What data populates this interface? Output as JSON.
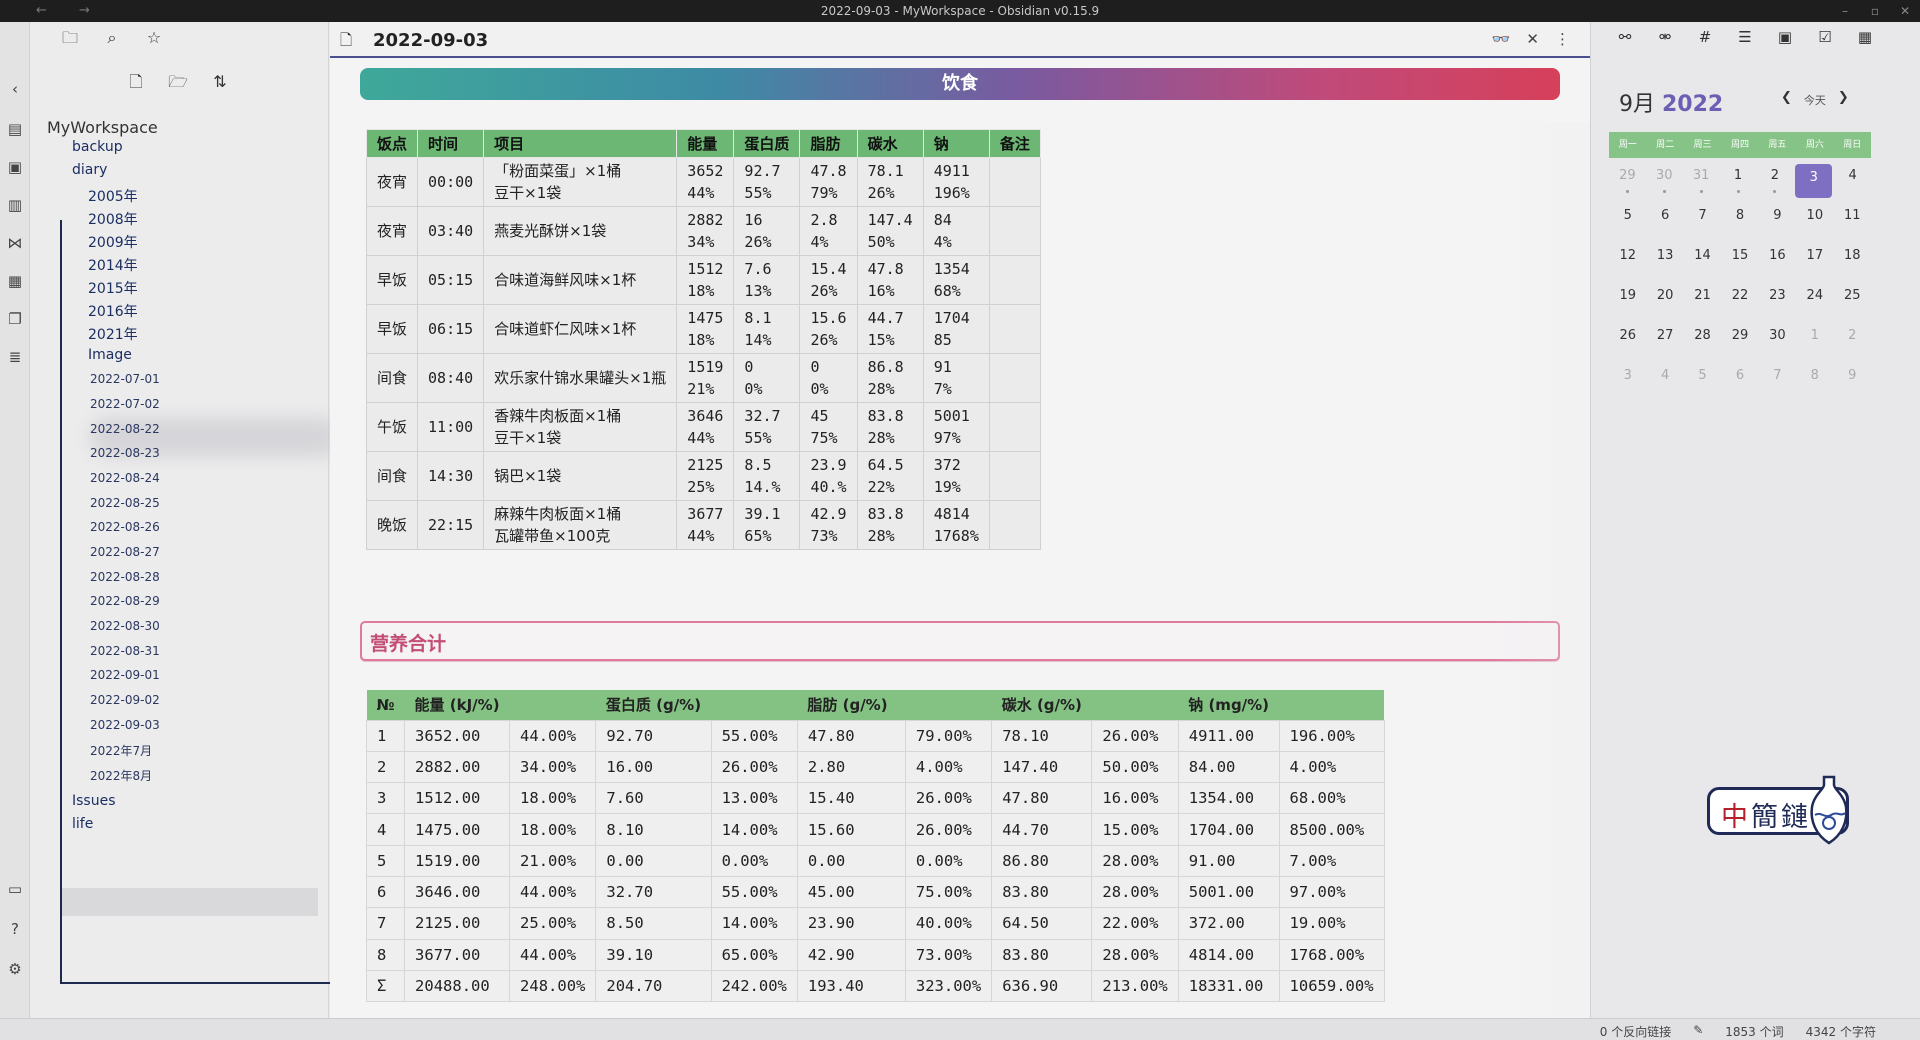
{
  "window": {
    "title": "2022-09-03 - MyWorkspace - Obsidian v0.15.9"
  },
  "sidebar": {
    "vault_name": "MyWorkspace",
    "items": [
      {
        "label": "backup",
        "type": "folder"
      },
      {
        "label": "diary",
        "type": "folder"
      },
      {
        "label": "2005年",
        "type": "folder"
      },
      {
        "label": "2008年",
        "type": "folder"
      },
      {
        "label": "2009年",
        "type": "folder"
      },
      {
        "label": "2014年",
        "type": "folder"
      },
      {
        "label": "2015年",
        "type": "folder"
      },
      {
        "label": "2016年",
        "type": "folder"
      },
      {
        "label": "2021年",
        "type": "folder"
      },
      {
        "label": "Image",
        "type": "folder"
      },
      {
        "label": "2022-07-01",
        "type": "file"
      },
      {
        "label": "2022-07-02",
        "type": "file"
      },
      {
        "label": "2022-08-22",
        "type": "file"
      },
      {
        "label": "2022-08-23",
        "type": "file"
      },
      {
        "label": "2022-08-24",
        "type": "file"
      },
      {
        "label": "2022-08-25",
        "type": "file"
      },
      {
        "label": "2022-08-26",
        "type": "file"
      },
      {
        "label": "2022-08-27",
        "type": "file"
      },
      {
        "label": "2022-08-28",
        "type": "file"
      },
      {
        "label": "2022-08-29",
        "type": "file"
      },
      {
        "label": "2022-08-30",
        "type": "file"
      },
      {
        "label": "2022-08-31",
        "type": "file"
      },
      {
        "label": "2022-09-01",
        "type": "file"
      },
      {
        "label": "2022-09-02",
        "type": "file"
      },
      {
        "label": "2022-09-03",
        "type": "file",
        "selected": true
      },
      {
        "label": "2022年7月",
        "type": "file"
      },
      {
        "label": "2022年8月",
        "type": "file"
      },
      {
        "label": "Issues",
        "type": "folder"
      },
      {
        "label": "life",
        "type": "folder"
      }
    ]
  },
  "editor": {
    "tab_title": "2022-09-03",
    "banner": "饮食",
    "meals_table": {
      "headers": [
        "饭点",
        "时间",
        "项目",
        "能量",
        "蛋白质",
        "脂肪",
        "碳水",
        "钠",
        "备注"
      ],
      "rows": [
        {
          "meal": "夜宵",
          "time": "00:00",
          "item1": "「粉面菜蛋」×1桶",
          "item2": "豆干×1袋",
          "energy": "3652",
          "energy_pct": "44%",
          "protein": "92.7",
          "protein_pct": "55%",
          "fat": "47.8",
          "fat_pct": "79%",
          "carb": "78.1",
          "carb_pct": "26%",
          "sodium": "4911",
          "sodium_pct": "196%",
          "note": ""
        },
        {
          "meal": "夜宵",
          "time": "03:40",
          "item1": "燕麦光酥饼×1袋",
          "item2": "",
          "energy": "2882",
          "energy_pct": "34%",
          "protein": "16",
          "protein_pct": "26%",
          "fat": "2.8",
          "fat_pct": "4%",
          "carb": "147.4",
          "carb_pct": "50%",
          "sodium": "84",
          "sodium_pct": "4%",
          "note": ""
        },
        {
          "meal": "早饭",
          "time": "05:15",
          "item1": "合味道海鲜风味×1杯",
          "item2": "",
          "energy": "1512",
          "energy_pct": "18%",
          "protein": "7.6",
          "protein_pct": "13%",
          "fat": "15.4",
          "fat_pct": "26%",
          "carb": "47.8",
          "carb_pct": "16%",
          "sodium": "1354",
          "sodium_pct": "68%",
          "note": ""
        },
        {
          "meal": "早饭",
          "time": "06:15",
          "item1": "合味道虾仁风味×1杯",
          "item2": "",
          "energy": "1475",
          "energy_pct": "18%",
          "protein": "8.1",
          "protein_pct": "14%",
          "fat": "15.6",
          "fat_pct": "26%",
          "carb": "44.7",
          "carb_pct": "15%",
          "sodium": "1704",
          "sodium_pct": "85",
          "note": ""
        },
        {
          "meal": "间食",
          "time": "08:40",
          "item1": "欢乐家什锦水果罐头×1瓶",
          "item2": "",
          "energy": "1519",
          "energy_pct": "21%",
          "protein": "0",
          "protein_pct": "0%",
          "fat": "0",
          "fat_pct": "0%",
          "carb": "86.8",
          "carb_pct": "28%",
          "sodium": "91",
          "sodium_pct": "7%",
          "note": ""
        },
        {
          "meal": "午饭",
          "time": "11:00",
          "item1": "香辣牛肉板面×1桶",
          "item2": "豆干×1袋",
          "energy": "3646",
          "energy_pct": "44%",
          "protein": "32.7",
          "protein_pct": "55%",
          "fat": "45",
          "fat_pct": "75%",
          "carb": "83.8",
          "carb_pct": "28%",
          "sodium": "5001",
          "sodium_pct": "97%",
          "note": ""
        },
        {
          "meal": "间食",
          "time": "14:30",
          "item1": "锅巴×1袋",
          "item2": "",
          "energy": "2125",
          "energy_pct": "25%",
          "protein": "8.5",
          "protein_pct": "14.%",
          "fat": "23.9",
          "fat_pct": "40.%",
          "carb": "64.5",
          "carb_pct": "22%",
          "sodium": "372",
          "sodium_pct": "19%",
          "note": ""
        },
        {
          "meal": "晚饭",
          "time": "22:15",
          "item1": "麻辣牛肉板面×1桶",
          "item2": "瓦罐带鱼×100克",
          "energy": "3677",
          "energy_pct": "44%",
          "protein": "39.1",
          "protein_pct": "65%",
          "fat": "42.9",
          "fat_pct": "73%",
          "carb": "83.8",
          "carb_pct": "28%",
          "sodium": "4814",
          "sodium_pct": "1768%",
          "note": ""
        }
      ]
    },
    "summary_heading": "营养合计",
    "summary_table": {
      "headers": [
        "№",
        "能量 (kJ/%)",
        "",
        "蛋白质 (g/%)",
        "",
        "脂肪 (g/%)",
        "",
        "碳水 (g/%)",
        "",
        "钠 (mg/%)",
        ""
      ],
      "rows": [
        [
          "1",
          "3652.00",
          "44.00%",
          "92.70",
          "55.00%",
          "47.80",
          "79.00%",
          "78.10",
          "26.00%",
          "4911.00",
          "196.00%"
        ],
        [
          "2",
          "2882.00",
          "34.00%",
          "16.00",
          "26.00%",
          "2.80",
          "4.00%",
          "147.40",
          "50.00%",
          "84.00",
          "4.00%"
        ],
        [
          "3",
          "1512.00",
          "18.00%",
          "7.60",
          "13.00%",
          "15.40",
          "26.00%",
          "47.80",
          "16.00%",
          "1354.00",
          "68.00%"
        ],
        [
          "4",
          "1475.00",
          "18.00%",
          "8.10",
          "14.00%",
          "15.60",
          "26.00%",
          "44.70",
          "15.00%",
          "1704.00",
          "8500.00%"
        ],
        [
          "5",
          "1519.00",
          "21.00%",
          "0.00",
          "0.00%",
          "0.00",
          "0.00%",
          "86.80",
          "28.00%",
          "91.00",
          "7.00%"
        ],
        [
          "6",
          "3646.00",
          "44.00%",
          "32.70",
          "55.00%",
          "45.00",
          "75.00%",
          "83.80",
          "28.00%",
          "5001.00",
          "97.00%"
        ],
        [
          "7",
          "2125.00",
          "25.00%",
          "8.50",
          "14.00%",
          "23.90",
          "40.00%",
          "64.50",
          "22.00%",
          "372.00",
          "19.00%"
        ],
        [
          "8",
          "3677.00",
          "44.00%",
          "39.10",
          "65.00%",
          "42.90",
          "73.00%",
          "83.80",
          "28.00%",
          "4814.00",
          "1768.00%"
        ],
        [
          "Σ",
          "20488.00",
          "248.00%",
          "204.70",
          "242.00%",
          "193.40",
          "323.00%",
          "636.90",
          "213.00%",
          "18331.00",
          "10659.00%"
        ]
      ]
    }
  },
  "calendar": {
    "month_label": "9月",
    "year_label": "2022",
    "today_label": "今天",
    "weekdays": [
      "周一",
      "周二",
      "周三",
      "周四",
      "周五",
      "周六",
      "周日"
    ],
    "weeks": [
      [
        {
          "d": "29",
          "o": true,
          "dot": true
        },
        {
          "d": "30",
          "o": true,
          "dot": true
        },
        {
          "d": "31",
          "o": true,
          "dot": true
        },
        {
          "d": "1",
          "dot": true
        },
        {
          "d": "2",
          "dot": true
        },
        {
          "d": "3",
          "today": true
        },
        {
          "d": "4"
        }
      ],
      [
        {
          "d": "5"
        },
        {
          "d": "6"
        },
        {
          "d": "7"
        },
        {
          "d": "8"
        },
        {
          "d": "9"
        },
        {
          "d": "10"
        },
        {
          "d": "11"
        }
      ],
      [
        {
          "d": "12"
        },
        {
          "d": "13"
        },
        {
          "d": "14"
        },
        {
          "d": "15"
        },
        {
          "d": "16"
        },
        {
          "d": "17"
        },
        {
          "d": "18"
        }
      ],
      [
        {
          "d": "19"
        },
        {
          "d": "20"
        },
        {
          "d": "21"
        },
        {
          "d": "22"
        },
        {
          "d": "23"
        },
        {
          "d": "24"
        },
        {
          "d": "25"
        }
      ],
      [
        {
          "d": "26"
        },
        {
          "d": "27"
        },
        {
          "d": "28"
        },
        {
          "d": "29"
        },
        {
          "d": "30"
        },
        {
          "d": "1",
          "o": true
        },
        {
          "d": "2",
          "o": true
        }
      ],
      [
        {
          "d": "3",
          "o": true
        },
        {
          "d": "4",
          "o": true
        },
        {
          "d": "5",
          "o": true
        },
        {
          "d": "6",
          "o": true
        },
        {
          "d": "7",
          "o": true
        },
        {
          "d": "8",
          "o": true
        },
        {
          "d": "9",
          "o": true
        }
      ]
    ]
  },
  "logo": {
    "text": "中簡鏈"
  },
  "statusbar": {
    "backlinks": "0 个反向链接",
    "words": "1853 个词",
    "chars": "4342 个字符"
  },
  "colors": {
    "accent": "#6c5fb3",
    "header_green": "#6cb774",
    "heading_pink": "#c44d73"
  }
}
